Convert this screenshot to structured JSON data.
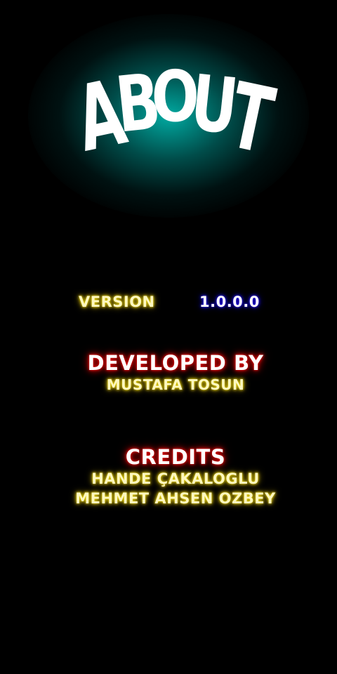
{
  "header": {
    "title_letters": [
      "A",
      "B",
      "O",
      "U",
      "T"
    ]
  },
  "version": {
    "label": "VERSION",
    "value": "1.0.0.0"
  },
  "developer": {
    "heading": "DEVELOPED BY",
    "name": "MUSTAFA TOSUN"
  },
  "credits": {
    "heading": "CREDITS",
    "names": [
      "HANDE ÇAKALOGLU",
      "MEHMET AHSEN OZBEY"
    ]
  },
  "colors": {
    "background": "#000000",
    "title_glow": "#00c8be",
    "label_glow": "#e8d400",
    "heading_glow": "#e00000",
    "version_glow": "#2a18ff"
  }
}
